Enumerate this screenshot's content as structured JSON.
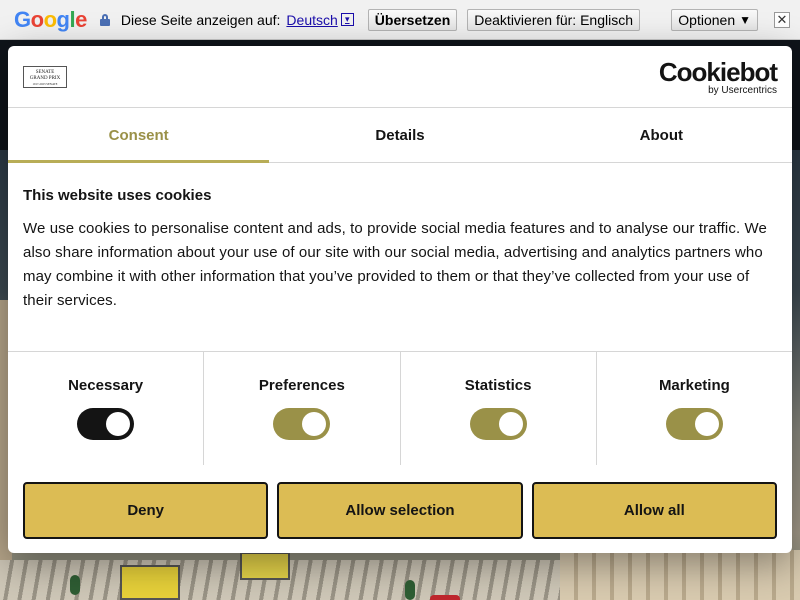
{
  "translate_bar": {
    "logo_letters": [
      {
        "char": "G",
        "color": "#4285f4"
      },
      {
        "char": "o",
        "color": "#ea4335"
      },
      {
        "char": "o",
        "color": "#fbbc05"
      },
      {
        "char": "g",
        "color": "#4285f4"
      },
      {
        "char": "l",
        "color": "#34a853"
      },
      {
        "char": "e",
        "color": "#ea4335"
      }
    ],
    "lock_icon": "lock-icon",
    "prompt_text": "Diese Seite anzeigen auf:",
    "language": "Deutsch",
    "language_dropdown_glyph": "▾",
    "translate_label": "Übersetzen",
    "deactivate_label": "Deaktivieren für: Englisch",
    "options_label": "Optionen",
    "options_arrow": "▼",
    "close_glyph": "✕"
  },
  "dialog": {
    "brand_logo": {
      "line1": "SENATE",
      "line2": "GRAND PRIX",
      "line3": "1917-2023 SENATE"
    },
    "cookiebot": {
      "word": "Cookiebot",
      "by": "by Usercentrics"
    },
    "tabs": [
      {
        "label": "Consent",
        "active": true
      },
      {
        "label": "Details",
        "active": false
      },
      {
        "label": "About",
        "active": false
      }
    ],
    "heading": "This website uses cookies",
    "body": "We use cookies to personalise content and ads, to provide social media features and to analyse our traffic. We also share information about your use of our site with our social media, advertising and analytics partners who may combine it with other information that you’ve provided to them or that they’ve collected from your use of their services.",
    "toggles": [
      {
        "label": "Necessary",
        "checked": true,
        "color": "#141414"
      },
      {
        "label": "Preferences",
        "checked": true,
        "color": "#9a9148"
      },
      {
        "label": "Statistics",
        "checked": true,
        "color": "#9a9148"
      },
      {
        "label": "Marketing",
        "checked": true,
        "color": "#9a9148"
      }
    ],
    "buttons": {
      "deny": "Deny",
      "allow_selection": "Allow selection",
      "allow_all": "Allow all"
    }
  },
  "colors": {
    "accent": "#9a9148",
    "button_fill": "#dcbc54",
    "link": "#1a0dab"
  }
}
